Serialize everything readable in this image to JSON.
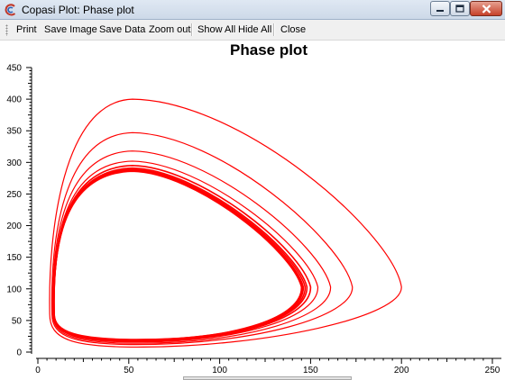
{
  "window": {
    "title": "Copasi Plot: Phase plot",
    "icon": "copasi-logo-icon",
    "controls": [
      "minimize-icon",
      "maximize-icon",
      "close-icon"
    ]
  },
  "toolbar": {
    "print": "Print",
    "save_image": "Save Image",
    "save_data": "Save Data",
    "zoom_out": "Zoom out",
    "show_all": "Show All",
    "hide_all": "Hide All",
    "close": "Close"
  },
  "chart_data": {
    "type": "line",
    "title": "Phase plot",
    "xlabel": "",
    "ylabel": "",
    "xlim": [
      0,
      250
    ],
    "ylim": [
      0,
      450
    ],
    "x_ticks": [
      0,
      50,
      100,
      150,
      200,
      250
    ],
    "y_ticks": [
      0,
      50,
      100,
      150,
      200,
      250,
      300,
      350,
      400,
      450
    ],
    "grid": false,
    "legend": "none",
    "line_color": "#ff0000",
    "description_of_series": "single trajectory spiralling inward onto a limit cycle",
    "series": [
      {
        "loops": [
          {
            "x_max": 200,
            "y_max": 400,
            "y_min": 8
          },
          {
            "x_max": 173,
            "y_max": 347,
            "y_min": 12
          },
          {
            "x_max": 161,
            "y_max": 318,
            "y_min": 14
          },
          {
            "x_max": 154,
            "y_max": 302,
            "y_min": 16
          },
          {
            "x_max": 150,
            "y_max": 295,
            "y_min": 17
          },
          {
            "x_max": 148,
            "y_max": 291,
            "y_min": 18
          },
          {
            "x_max": 147,
            "y_max": 289,
            "y_min": 19
          },
          {
            "x_max": 146,
            "y_max": 288,
            "y_min": 19
          },
          {
            "x_max": 145.5,
            "y_max": 287,
            "y_min": 19.5
          },
          {
            "x_max": 145,
            "y_max": 286,
            "y_min": 20
          }
        ]
      }
    ]
  }
}
